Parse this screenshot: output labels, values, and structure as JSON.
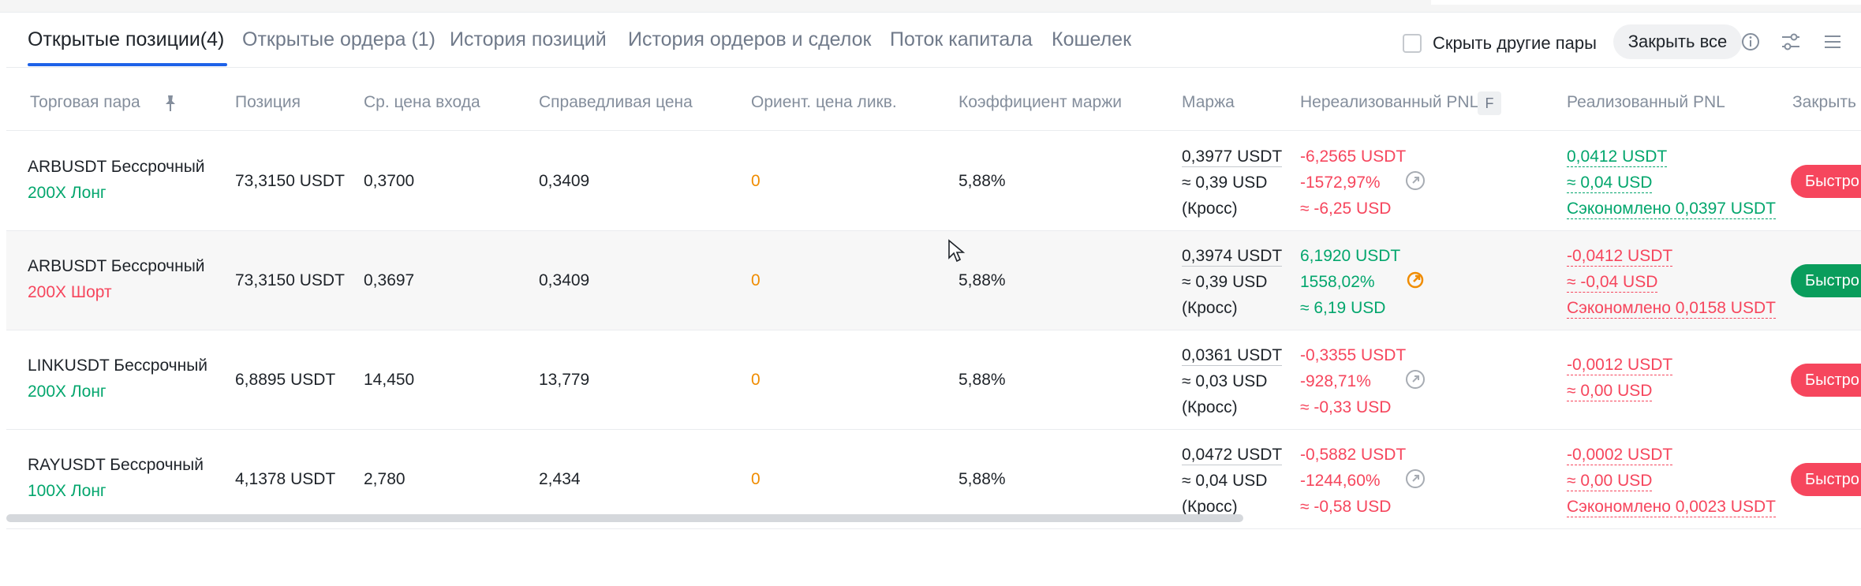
{
  "tabs": [
    {
      "label": "Открытые позиции(4)",
      "active": true
    },
    {
      "label": "Открытые ордера (1)"
    },
    {
      "label": "История позиций"
    },
    {
      "label": "История ордеров и сделок"
    },
    {
      "label": "Поток капитала"
    },
    {
      "label": "Кошелек"
    }
  ],
  "toolbar": {
    "hide_other_pairs": "Скрыть другие пары",
    "close_all": "Закрыть все",
    "icons": [
      "info-icon",
      "sliders-icon",
      "menu-icon"
    ]
  },
  "columns": {
    "pair": "Торговая пара",
    "position": "Позиция",
    "entry": "Ср. цена входа",
    "fair": "Справедливая цена",
    "liq": "Ориент. цена ликв.",
    "margin_ratio": "Коэффициент маржи",
    "margin": "Маржа",
    "unrealized": "Нереализованный PNL",
    "unrealized_badge": "F",
    "realized": "Реализованный PNL",
    "close": "Закрыть"
  },
  "rows": [
    {
      "symbol": "ARBUSDT Бессрочный",
      "leverage": "200X Лонг",
      "side": "long",
      "position": "73,3150 USDT",
      "entry": "0,3700",
      "fair": "0,3409",
      "liq": "0",
      "margin_ratio": "5,88%",
      "margin": [
        "0,3977 USDT",
        "≈ 0,39 USD",
        "(Кросс)"
      ],
      "unrealized": [
        "-6,2565 USDT",
        "-1572,97%",
        "≈ -6,25 USD"
      ],
      "unrealized_sign": "neg",
      "realized": [
        "0,0412 USDT",
        "≈ 0,04 USD",
        "Сэкономлено 0,0397 USDT"
      ],
      "realized_sign": "pos",
      "close_btn": "Быстро"
    },
    {
      "symbol": "ARBUSDT Бессрочный",
      "leverage": "200X Шорт",
      "side": "short",
      "position": "73,3150 USDT",
      "entry": "0,3697",
      "fair": "0,3409",
      "liq": "0",
      "margin_ratio": "5,88%",
      "margin": [
        "0,3974 USDT",
        "≈ 0,39 USD",
        "(Кросс)"
      ],
      "unrealized": [
        "6,1920 USDT",
        "1558,02%",
        "≈ 6,19 USD"
      ],
      "unrealized_sign": "pos",
      "realized": [
        "-0,0412 USDT",
        "≈ -0,04 USD",
        "Сэкономлено 0,0158 USDT"
      ],
      "realized_sign": "neg",
      "close_btn": "Быстро"
    },
    {
      "symbol": "LINKUSDT Бессрочный",
      "leverage": "200X Лонг",
      "side": "long",
      "position": "6,8895 USDT",
      "entry": "14,450",
      "fair": "13,779",
      "liq": "0",
      "margin_ratio": "5,88%",
      "margin": [
        "0,0361 USDT",
        "≈ 0,03 USD",
        "(Кросс)"
      ],
      "unrealized": [
        "-0,3355 USDT",
        "-928,71%",
        "≈ -0,33 USD"
      ],
      "unrealized_sign": "neg",
      "realized": [
        "-0,0012 USDT",
        "≈ 0,00 USD",
        ""
      ],
      "realized_sign": "neg",
      "close_btn": "Быстро"
    },
    {
      "symbol": "RAYUSDT Бессрочный",
      "leverage": "100X Лонг",
      "side": "long",
      "position": "4,1378 USDT",
      "entry": "2,780",
      "fair": "2,434",
      "liq": "0",
      "margin_ratio": "5,88%",
      "margin": [
        "0,0472 USDT",
        "≈ 0,04 USD",
        "(Кросс)"
      ],
      "unrealized": [
        "-0,5882 USDT",
        "-1244,60%",
        "≈ -0,58 USD"
      ],
      "unrealized_sign": "neg",
      "realized": [
        "-0,0002 USDT",
        "≈ 0,00 USD",
        "Сэкономлено 0,0023 USDT"
      ],
      "realized_sign": "neg",
      "close_btn": "Быстро"
    }
  ]
}
